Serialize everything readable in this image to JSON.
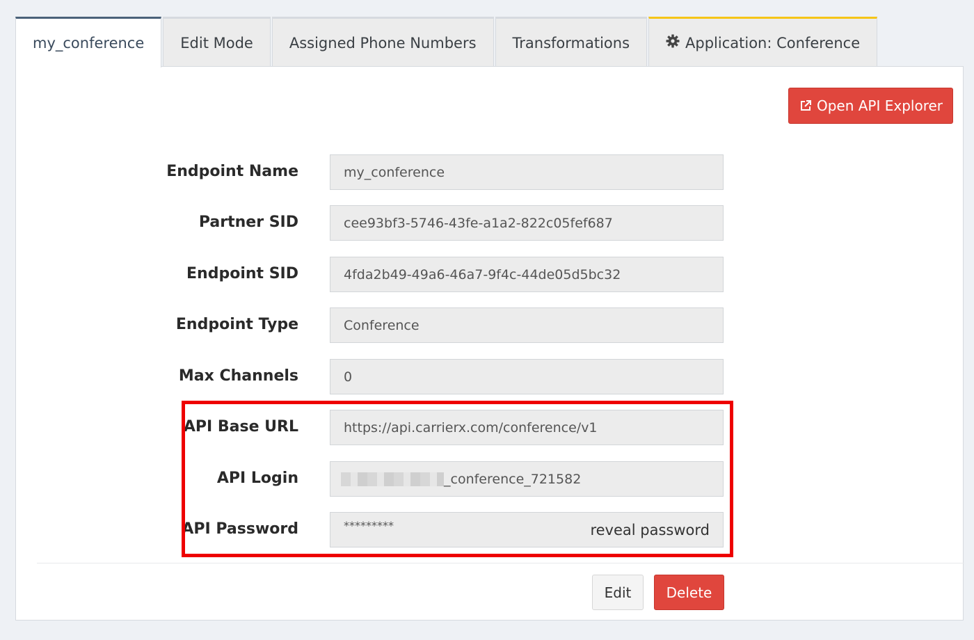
{
  "tabs": [
    {
      "label": "my_conference",
      "active": true
    },
    {
      "label": "Edit Mode"
    },
    {
      "label": "Assigned Phone Numbers"
    },
    {
      "label": "Transformations"
    },
    {
      "label": "Application: Conference",
      "icon": "gear-icon"
    }
  ],
  "toolbar": {
    "api_explorer_label": "Open API Explorer",
    "api_explorer_icon": "external-link-icon"
  },
  "fields": {
    "endpoint_name": {
      "label": "Endpoint Name",
      "value": "my_conference"
    },
    "partner_sid": {
      "label": "Partner SID",
      "value": "cee93bf3-5746-43fe-a1a2-822c05fef687"
    },
    "endpoint_sid": {
      "label": "Endpoint SID",
      "value": "4fda2b49-49a6-46a7-9f4c-44de05d5bc32"
    },
    "endpoint_type": {
      "label": "Endpoint Type",
      "value": "Conference"
    },
    "max_channels": {
      "label": "Max Channels",
      "value": "0"
    },
    "api_base_url": {
      "label": "API Base URL",
      "value": "https://api.carrierx.com/conference/v1"
    },
    "api_login": {
      "label": "API Login",
      "value_suffix": "_conference_721582"
    },
    "api_password": {
      "label": "API Password",
      "value": "*********",
      "reveal_label": "reveal password"
    }
  },
  "actions": {
    "edit_label": "Edit",
    "delete_label": "Delete"
  },
  "colors": {
    "accent_red": "#e0463d",
    "highlight_red": "#ee0000",
    "active_tab_border": "#4a6179",
    "app_tab_border": "#f5c518"
  }
}
